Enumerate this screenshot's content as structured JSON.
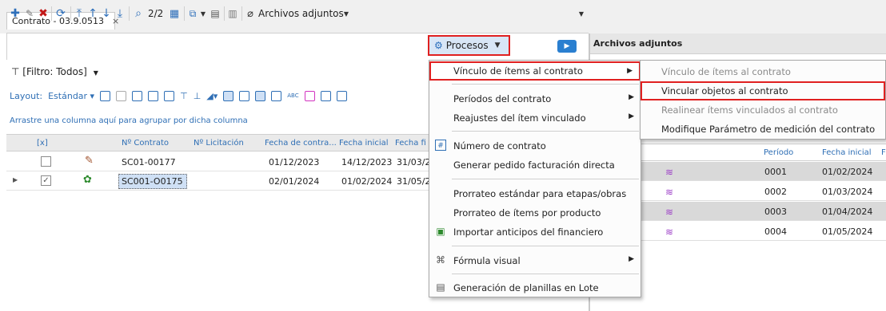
{
  "tab": {
    "title": "Contrato - 03.9.0513",
    "close": "×"
  },
  "toolbar": {
    "page": "2/2",
    "attachments": "Archivos adjuntos",
    "procesos": "Procesos"
  },
  "right_pane": {
    "title": "Archivos adjuntos"
  },
  "filter": {
    "label": "[Filtro: Todos]"
  },
  "layout": {
    "label": "Layout:",
    "value": "Estándar"
  },
  "group_hint": "Arrastre una columna aquí para agrupar por dicha columna",
  "grid": {
    "headers": [
      "[x]",
      "Nº Contrato",
      "Nº Licitación",
      "Fecha de contra...",
      "Fecha inicial",
      "Fecha fi"
    ],
    "rows": [
      {
        "contrato": "SC01-00177",
        "licitacion": "",
        "fecha_contrato": "01/12/2023",
        "fecha_inicial": "14/12/2023",
        "fecha_fin": "31/03/2",
        "checked": false
      },
      {
        "contrato": "SC001-O0175",
        "licitacion": "",
        "fecha_contrato": "02/01/2024",
        "fecha_inicial": "01/02/2024",
        "fecha_fin": "31/05/2",
        "checked": true
      }
    ]
  },
  "menu": {
    "items": [
      {
        "label": "Vínculo de ítems al contrato"
      },
      {
        "label": "Períodos del contrato"
      },
      {
        "label": "Reajustes del ítem vinculado"
      },
      {
        "label": "Número de contrato"
      },
      {
        "label": "Generar pedido facturación directa"
      },
      {
        "label": "Prorrateo estándar para etapas/obras"
      },
      {
        "label": "Prorrateo de ítems por producto"
      },
      {
        "label": "Importar anticipos del financiero"
      },
      {
        "label": "Fórmula visual"
      },
      {
        "label": "Generación de planillas en Lote"
      }
    ]
  },
  "submenu": {
    "items": [
      {
        "label": "Vínculo de ítems al contrato"
      },
      {
        "label": "Vincular objetos al contrato"
      },
      {
        "label": "Realinear ítems vinculados al contrato"
      },
      {
        "label": "Modifique Parámetro de medición del contrato"
      }
    ]
  },
  "right_grid": {
    "headers": [
      "Período",
      "Fecha inicial",
      "F"
    ],
    "rows": [
      {
        "periodo": "0001",
        "fecha": "01/02/2024"
      },
      {
        "periodo": "0002",
        "fecha": "01/03/2024"
      },
      {
        "periodo": "0003",
        "fecha": "01/04/2024"
      },
      {
        "periodo": "0004",
        "fecha": "01/05/2024"
      }
    ]
  },
  "colors": {
    "highlight_border": "#e02020",
    "accent_blue": "#2f6fb5",
    "wave_purple": "#9b3cc6"
  }
}
